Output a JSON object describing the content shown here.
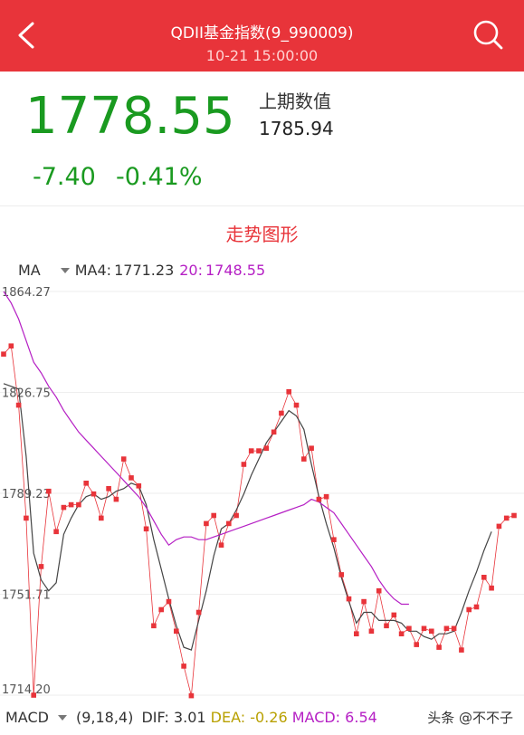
{
  "header": {
    "title": "QDII基金指数(9_990009)",
    "subtitle": "10-21 15:00:00",
    "back_icon": "chevron-left-icon",
    "search_icon": "search-icon",
    "bg_color": "#e8343a"
  },
  "quote": {
    "price": "1778.55",
    "change": "-7.40",
    "change_pct": "-0.41%",
    "prev_label": "上期数值",
    "prev_value": "1785.94",
    "down_color": "#1a9a20"
  },
  "section_title": "走势图形",
  "ma_bar": {
    "selector": "MA",
    "ma4_label": "MA4:",
    "ma4_value": "1771.23",
    "ma20_label": "20:",
    "ma20_value": "1748.55",
    "ma4_color": "#444444",
    "ma20_color": "#b51fc4"
  },
  "macd_bar": {
    "selector": "MACD",
    "params": "(9,18,4)",
    "dif_label": "DIF:",
    "dif_value": "3.01",
    "dea_label": "DEA:",
    "dea_value": "-0.26",
    "macd_label": "MACD:",
    "macd_value": "6.54",
    "dea_color": "#b8a000",
    "macd_color": "#b51fc4"
  },
  "watermark": "头条 @不不子",
  "chart_data": {
    "type": "line",
    "y_ticks": [
      "1864.27",
      "1826.75",
      "1789.23",
      "1751.71",
      "1714.20"
    ],
    "ylim": [
      1714.2,
      1864.27
    ],
    "series": [
      {
        "name": "",
        "color": "#e8343a",
        "values": [
          1841,
          1844,
          1822,
          1780,
          1714.2,
          1762,
          1790,
          1775,
          1784,
          1785,
          1785,
          1793,
          1789,
          1780,
          1791,
          1787,
          1802,
          1795,
          1792,
          1776,
          1740,
          1746,
          1749,
          1738,
          1725,
          1714,
          1745,
          1778,
          1781,
          1770,
          1778,
          1781,
          1800,
          1805,
          1805,
          1806,
          1812,
          1819,
          1827,
          1822,
          1802,
          1806,
          1787,
          1788,
          1772,
          1759,
          1750,
          1737,
          1749,
          1738,
          1753,
          1740,
          1744,
          1737,
          1739,
          1733,
          1739,
          1738,
          1732,
          1739,
          1739,
          1731,
          1746,
          1747,
          1758,
          1754,
          1777,
          1780,
          1781
        ]
      },
      {
        "name": "MA4",
        "color": "#444444",
        "values": [
          1830,
          1829,
          1828,
          1803,
          1767,
          1757,
          1753,
          1756,
          1774,
          1780,
          1785,
          1788,
          1789,
          1787,
          1788,
          1790,
          1791,
          1793,
          1792,
          1785,
          1772,
          1761,
          1750,
          1740,
          1732,
          1731,
          1742,
          1753,
          1766,
          1776,
          1778,
          1783,
          1789,
          1796,
          1802,
          1808,
          1812,
          1816,
          1820,
          1818,
          1813,
          1800,
          1788,
          1778,
          1769,
          1758,
          1749,
          1741,
          1745,
          1745,
          1742,
          1742,
          1742,
          1741,
          1738,
          1738,
          1736,
          1735,
          1737,
          1737,
          1738,
          1745,
          1753,
          1760,
          1768,
          1775
        ]
      },
      {
        "name": "20",
        "color": "#b51fc4",
        "values": [
          1864.27,
          1860,
          1854,
          1846,
          1838,
          1834,
          1829,
          1825,
          1820,
          1816,
          1812,
          1809,
          1806,
          1803,
          1800,
          1797,
          1794,
          1791,
          1788,
          1784,
          1779,
          1774,
          1770,
          1772,
          1773,
          1773,
          1772,
          1772,
          1773,
          1774,
          1775,
          1776,
          1777,
          1778,
          1779,
          1780,
          1781,
          1782,
          1783,
          1784,
          1785,
          1787,
          1786,
          1784,
          1782,
          1778,
          1774,
          1770,
          1766,
          1762,
          1757,
          1753,
          1750,
          1748,
          1748
        ]
      }
    ]
  }
}
